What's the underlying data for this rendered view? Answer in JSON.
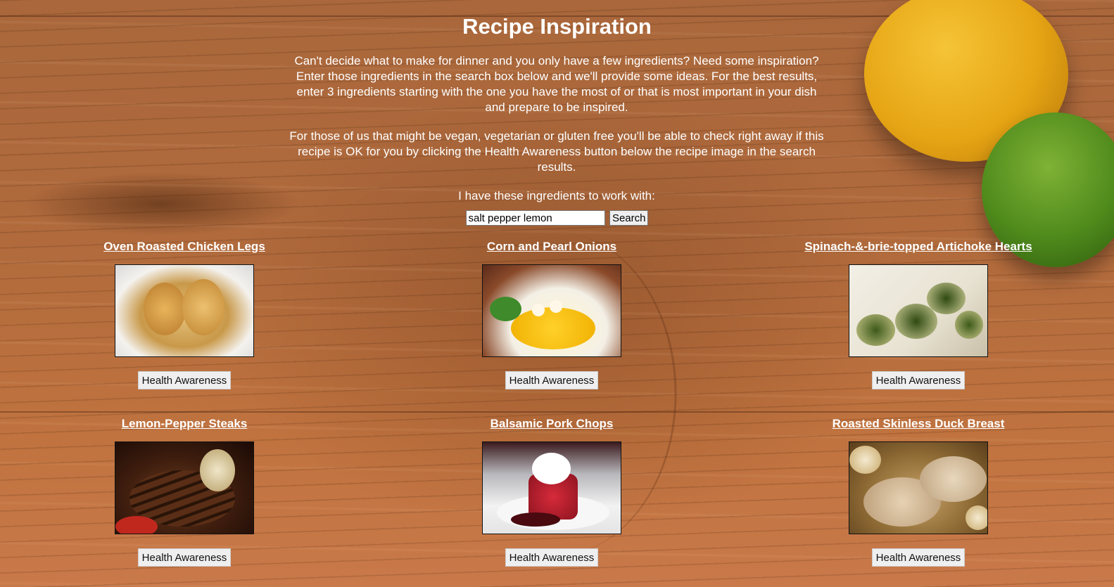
{
  "page": {
    "title": "Recipe Inspiration",
    "intro_1": "Can't decide what to make for dinner and you only have a few ingredients? Need some inspiration? Enter those ingredients in the search box below and we'll provide some ideas. For the best results, enter 3 ingredients starting with the one you have the most of or that is most important in your dish and prepare to be inspired.",
    "intro_2": "For those of us that might be vegan, vegetarian or gluten free you'll be able to check right away if this recipe is OK for you by clicking the Health Awareness button below the recipe image in the search results.",
    "prompt": "I have these ingredients to work with:"
  },
  "search": {
    "value": "salt pepper lemon",
    "button_label": "Search"
  },
  "results": [
    {
      "title": "Oven Roasted Chicken Legs",
      "button_label": "Health Awareness",
      "image_icon": "roasted-chicken-photo"
    },
    {
      "title": "Corn and Pearl Onions",
      "button_label": "Health Awareness",
      "image_icon": "corn-onions-photo"
    },
    {
      "title": "Spinach-&-brie-topped Artichoke Hearts",
      "button_label": "Health Awareness",
      "image_icon": "artichoke-photo"
    },
    {
      "title": "Lemon-Pepper Steaks",
      "button_label": "Health Awareness",
      "image_icon": "steak-photo"
    },
    {
      "title": "Balsamic Pork Chops",
      "button_label": "Health Awareness",
      "image_icon": "dessert-photo"
    },
    {
      "title": "Roasted Skinless Duck Breast",
      "button_label": "Health Awareness",
      "image_icon": "duck-breast-photo"
    }
  ]
}
